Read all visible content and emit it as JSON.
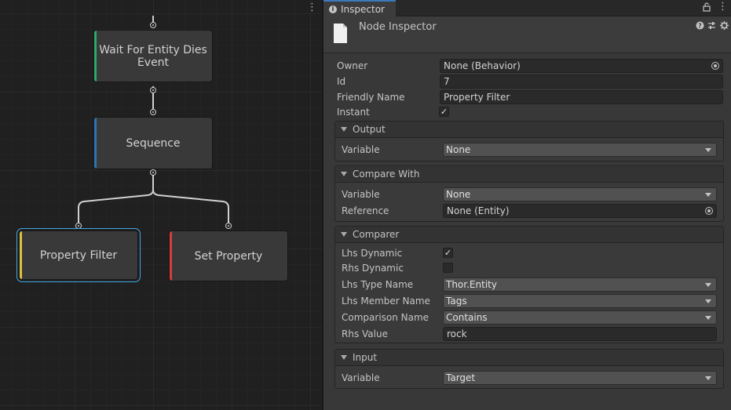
{
  "graph": {
    "nodes": [
      {
        "id": "wait",
        "label": "Wait For Entity Dies Event",
        "accent": "#2fa86a"
      },
      {
        "id": "sequence",
        "label": "Sequence",
        "accent": "#2a76b5"
      },
      {
        "id": "property_filter",
        "label": "Property Filter",
        "accent": "#e2c23a",
        "selected": true
      },
      {
        "id": "set_property",
        "label": "Set Property",
        "accent": "#d93d3d"
      }
    ],
    "selection_color": "#3fa8e6",
    "menu_icon": "kebab-menu-icon"
  },
  "tab": {
    "label": "Inspector",
    "icons": [
      "info-icon",
      "lock-icon",
      "kebab-menu-icon"
    ],
    "accent": "#3a79bb"
  },
  "header": {
    "title": "Node Inspector",
    "icons": [
      "help-icon",
      "settings-sliders-icon",
      "gear-icon"
    ]
  },
  "fields": {
    "owner": {
      "label": "Owner",
      "value": "None (Behavior)"
    },
    "id": {
      "label": "Id",
      "value": "7"
    },
    "friendly_name": {
      "label": "Friendly Name",
      "value": "Property Filter"
    },
    "instant": {
      "label": "Instant",
      "checked": true
    }
  },
  "groups": {
    "output": {
      "title": "Output",
      "variable": {
        "label": "Variable",
        "value": "None"
      }
    },
    "compare_with": {
      "title": "Compare With",
      "variable": {
        "label": "Variable",
        "value": "None"
      },
      "reference": {
        "label": "Reference",
        "value": "None (Entity)"
      }
    },
    "comparer": {
      "title": "Comparer",
      "lhs_dynamic": {
        "label": "Lhs Dynamic",
        "checked": true
      },
      "rhs_dynamic": {
        "label": "Rhs Dynamic",
        "checked": false
      },
      "lhs_type_name": {
        "label": "Lhs Type Name",
        "value": "Thor.Entity"
      },
      "lhs_member_name": {
        "label": "Lhs Member Name",
        "value": "Tags"
      },
      "comparison_name": {
        "label": "Comparison Name",
        "value": "Contains"
      },
      "rhs_value": {
        "label": "Rhs Value",
        "value": "rock"
      }
    },
    "input": {
      "title": "Input",
      "variable": {
        "label": "Variable",
        "value": "Target"
      }
    }
  },
  "check_glyph": "✓"
}
